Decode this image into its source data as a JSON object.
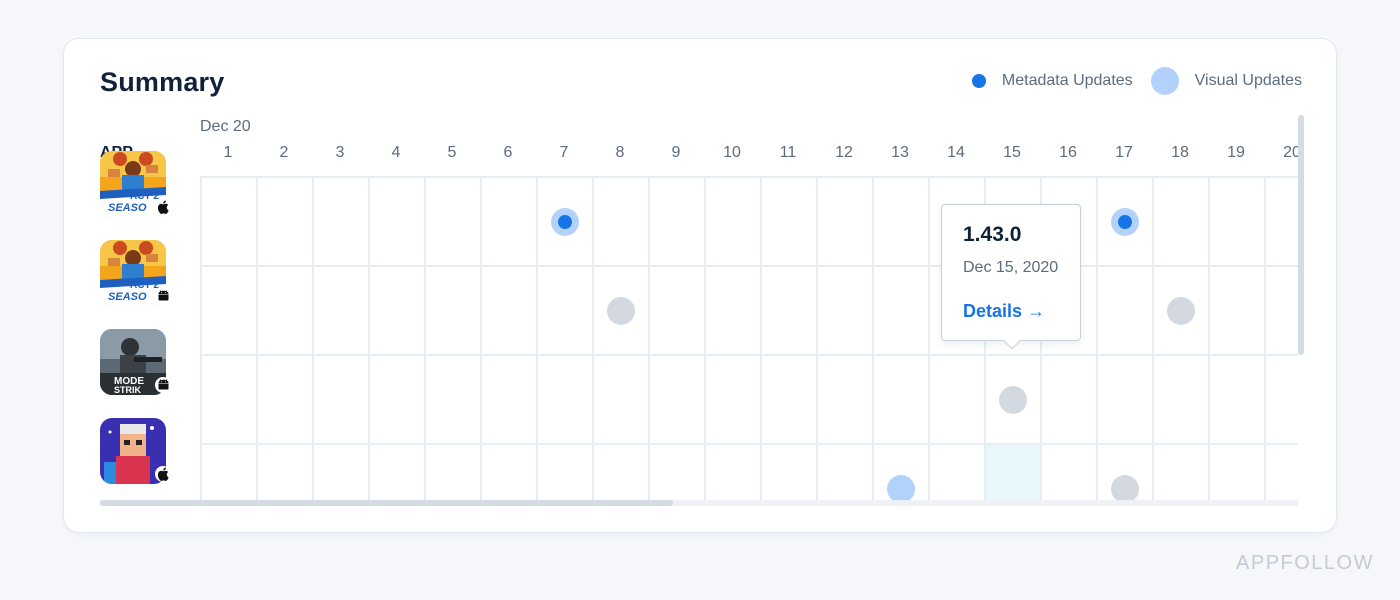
{
  "summary": {
    "title": "Summary"
  },
  "legend": {
    "metadata_label": "Metadata Updates",
    "visual_label": "Visual Updates"
  },
  "calendar": {
    "month_label": "Dec 20",
    "app_column_header": "APP",
    "days": [
      "1",
      "2",
      "3",
      "4",
      "5",
      "6",
      "7",
      "8",
      "9",
      "10",
      "11",
      "12",
      "13",
      "14",
      "15",
      "16",
      "17",
      "18",
      "19",
      "20"
    ]
  },
  "apps": [
    {
      "platform": "ios",
      "platform_icon": "apple-icon",
      "icon_text": [
        "ACT 2",
        "SEASO"
      ],
      "updates": [
        {
          "day": 7,
          "type": "metadata"
        },
        {
          "day": 17,
          "type": "metadata"
        }
      ]
    },
    {
      "platform": "android",
      "platform_icon": "android-icon",
      "icon_text": [
        "ACT 2",
        "SEASO"
      ],
      "updates": [
        {
          "day": 8,
          "type": "other"
        },
        {
          "day": 18,
          "type": "other"
        }
      ]
    },
    {
      "platform": "android",
      "platform_icon": "android-icon",
      "icon_text": [
        "MODE",
        "STRIK"
      ],
      "updates": [
        {
          "day": 15,
          "type": "other"
        }
      ]
    },
    {
      "platform": "ios",
      "platform_icon": "apple-icon",
      "icon_text": [],
      "updates": [
        {
          "day": 13,
          "type": "visual"
        },
        {
          "day": 17,
          "type": "other"
        }
      ]
    }
  ],
  "highlight": {
    "row": 3,
    "day": 15
  },
  "tooltip": {
    "version": "1.43.0",
    "date": "Dec 15, 2020",
    "link": "Details →"
  },
  "horizontal_scroll": {
    "position_fraction": 0.48
  },
  "watermark": "APPFOLLOW",
  "colors": {
    "metadata": "#1774e6",
    "visual": "#b3d2fb",
    "other": "#d4d9e1",
    "highlight": "#e7f7fc"
  }
}
